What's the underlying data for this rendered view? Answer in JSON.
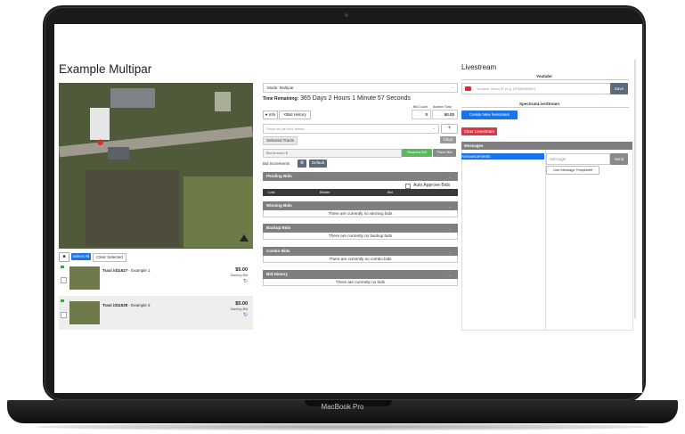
{
  "device": {
    "brand_label": "MacBook Pro"
  },
  "page": {
    "title": "Example Multipar"
  },
  "left": {
    "select_all": "Select All",
    "clear_selected": "Clear Selected",
    "tracts": [
      {
        "id": "Tract id11527",
        "name": "- Example 1",
        "price": "$5.00",
        "price_label": "Starting Bid"
      },
      {
        "id": "Tract id11528",
        "name": "- Example 2",
        "price": "$5.00",
        "price_label": "Starting Bid"
      }
    ]
  },
  "middle": {
    "mode": "Mode: Multipar",
    "time_label": "Time Remaining:",
    "time_value": "365 Days 2 Hours 1 Minute 57 Seconds",
    "info_label": "Info",
    "bid_history_label": "Bid History",
    "bid_count_label": "Bid Count",
    "bid_count": "0",
    "auction_total_label": "Auction Total",
    "auction_total": "$0.00",
    "floor_placeholder": "Place bid as floor bidder",
    "plus": "+",
    "selected_tracts": "Selected Tracts",
    "clear": "Clear",
    "bid_amount_placeholder": "Bid Amount $",
    "request_bid": "Request Bid",
    "place_bid": "Place Bid",
    "bid_increments": "Bid Increments",
    "default": "Default",
    "pending_bids": "Pending Bids",
    "auto_approve": "Auto Approve Bids",
    "col_lots": "Lots",
    "col_bidder": "Bidder",
    "col_bid": "Bid",
    "winning_bids": "Winning Bids",
    "winning_empty": "There are currently no winning bids",
    "backup_bids": "Backup Bids",
    "backup_empty": "There are currently no backup bids",
    "combo_bids": "Combo Bids",
    "combo_empty": "There are currently no combo bids",
    "bid_history": "Bid History",
    "history_empty": "There are currently no bids",
    "collapse": "_"
  },
  "right": {
    "livestream": "Livestream",
    "youtube": "Youtube",
    "youtube_placeholder": "Youtube Video ID (e.g. DPfdRk0RhE)",
    "save": "Save",
    "spectrum": "SpectrumLiveStream",
    "create_new": "Create New livestream",
    "clear_livestream": "Clear Livestream",
    "messages": "Messages",
    "announcements": "Announcements",
    "message_placeholder": "Message",
    "send": "Send",
    "use_template": "Use Message Template"
  },
  "colors": {
    "primary": "#1a73e8",
    "success": "#5cb85c",
    "danger": "#dc3545",
    "panel": "#7f7f7f"
  }
}
